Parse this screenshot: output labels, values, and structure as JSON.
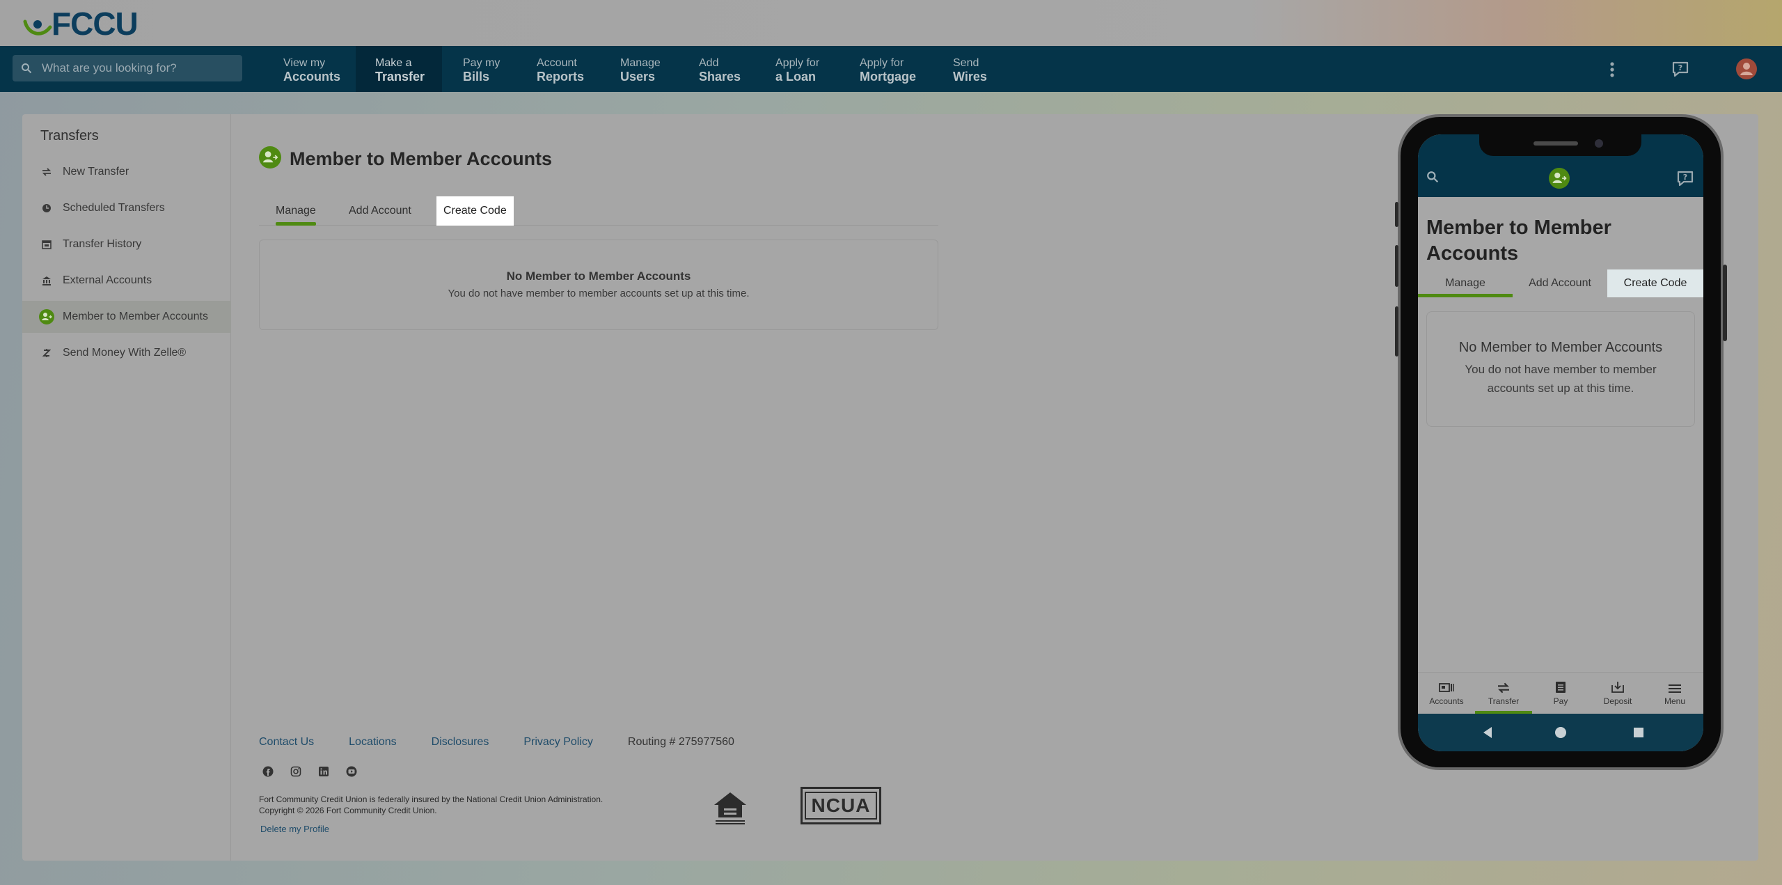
{
  "brand": {
    "name": "FCCU"
  },
  "search": {
    "placeholder": "What are you looking for?"
  },
  "nav": {
    "items": [
      {
        "line1": "View my",
        "line2": "Accounts"
      },
      {
        "line1": "Make a",
        "line2": "Transfer"
      },
      {
        "line1": "Pay my",
        "line2": "Bills"
      },
      {
        "line1": "Account",
        "line2": "Reports"
      },
      {
        "line1": "Manage",
        "line2": "Users"
      },
      {
        "line1": "Add",
        "line2": "Shares"
      },
      {
        "line1": "Apply for",
        "line2": "a Loan"
      },
      {
        "line1": "Apply for",
        "line2": "Mortgage"
      },
      {
        "line1": "Send",
        "line2": "Wires"
      }
    ],
    "icons": [
      "more-vertical-icon",
      "help-chat-icon",
      "user-avatar-icon"
    ]
  },
  "sidebar": {
    "title": "Transfers",
    "items": [
      {
        "label": "New Transfer",
        "icon": "transfer-arrows-icon"
      },
      {
        "label": "Scheduled Transfers",
        "icon": "clock-icon"
      },
      {
        "label": "Transfer History",
        "icon": "calendar-icon"
      },
      {
        "label": "External Accounts",
        "icon": "bank-icon"
      },
      {
        "label": "Member to Member Accounts",
        "icon": "member-transfer-icon"
      },
      {
        "label": "Send Money With Zelle®",
        "icon": "zelle-icon"
      }
    ]
  },
  "page": {
    "title": "Member to Member Accounts",
    "tabs": [
      "Manage",
      "Add Account",
      "Create Code"
    ],
    "empty_title": "No Member to Member Accounts",
    "empty_text": "You do not have member to member accounts set up at this time."
  },
  "footer": {
    "links": [
      "Contact Us",
      "Locations",
      "Disclosures",
      "Privacy Policy"
    ],
    "routing": "Routing # 275977560",
    "socials": [
      "facebook-icon",
      "instagram-icon",
      "linkedin-icon",
      "youtube-icon"
    ],
    "legal_line1": "Fort Community Credit Union is federally insured by the National Credit Union Administration.",
    "legal_line2": "Copyright © 2026 Fort Community Credit Union.",
    "delete_profile": "Delete my Profile",
    "ncua": "NCUA"
  },
  "mobile": {
    "title": "Member to Member Accounts",
    "tabs": [
      "Manage",
      "Add Account",
      "Create Code"
    ],
    "empty_title": "No Member to Member Accounts",
    "empty_text": "You do not have member to member accounts set up at this time.",
    "bottom_nav": [
      "Accounts",
      "Transfer",
      "Pay",
      "Deposit",
      "Menu"
    ]
  },
  "colors": {
    "navbar": "#053449",
    "accent_green": "#4f8a12",
    "link": "#1f4c6a"
  }
}
